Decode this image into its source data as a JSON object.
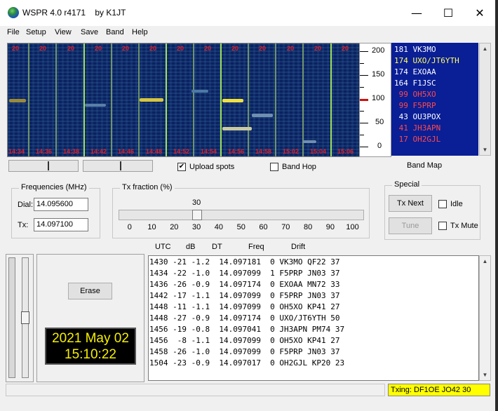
{
  "titlebar": {
    "title": "WSPR 4.0 r4171    by K1JT",
    "minimize": "—",
    "maximize": "☐",
    "close": "✕"
  },
  "menu": [
    "File",
    "Setup",
    "View",
    "Save",
    "Band",
    "Help"
  ],
  "waterfall": {
    "top_labels": [
      "20",
      "20",
      "20",
      "20",
      "20",
      "20",
      "20",
      "20",
      "20",
      "20",
      "20",
      "20",
      "20"
    ],
    "time_labels": [
      "14:34",
      "14:36",
      "14:38",
      "14:42",
      "14:46",
      "14:48",
      "14:52",
      "14:54",
      "14:56",
      "14:58",
      "15:02",
      "15:04",
      "15:06"
    ]
  },
  "scale": {
    "labels": [
      "200",
      "150",
      "100",
      "50",
      "0"
    ],
    "marker_value": 100
  },
  "band_map": {
    "label": "Band Map",
    "entries": [
      {
        "offset": "181",
        "call": "VK3MO",
        "color": "#ffffff"
      },
      {
        "offset": "174",
        "call": "UXO/JT6YTH",
        "color": "#ffff60"
      },
      {
        "offset": "174",
        "call": "EXOAA",
        "color": "#ffffff"
      },
      {
        "offset": "164",
        "call": "F1JSC",
        "color": "#ffffff"
      },
      {
        "offset": " 99",
        "call": "OH5XO",
        "color": "#ff4a4a"
      },
      {
        "offset": " 99",
        "call": "F5PRP",
        "color": "#ff4a4a"
      },
      {
        "offset": " 43",
        "call": "OU3POX",
        "color": "#ffffff"
      },
      {
        "offset": " 41",
        "call": "JH3APN",
        "color": "#ff4a4a"
      },
      {
        "offset": " 17",
        "call": "OH2GJL",
        "color": "#ff4a4a"
      }
    ]
  },
  "options": {
    "upload_spots": "Upload spots",
    "upload_checked": "✔",
    "band_hop": "Band Hop"
  },
  "frequencies": {
    "title": "Frequencies (MHz)",
    "dial_label": "Dial:",
    "dial_value": "14.095600",
    "tx_label": "Tx:",
    "tx_value": "14.097100"
  },
  "tx_fraction": {
    "title": "Tx fraction (%)",
    "value": "30",
    "ticks": [
      "0",
      "10",
      "20",
      "30",
      "40",
      "50",
      "60",
      "70",
      "80",
      "90",
      "100"
    ],
    "fraction": 0.3
  },
  "special": {
    "title": "Special",
    "tx_next": "Tx Next",
    "idle": "Idle",
    "tune": "Tune",
    "tx_mute": "Tx Mute"
  },
  "columns": {
    "utc": "UTC",
    "db": "dB",
    "dt": "DT",
    "freq": "Freq",
    "drift": "Drift"
  },
  "log": [
    "1430 -21 -1.2  14.097181  0 VK3MO QF22 37",
    "1434 -22 -1.0  14.097099  1 F5PRP JN03 37",
    "1436 -26 -0.9  14.097174  0 EXOAA MN72 33",
    "1442 -17 -1.1  14.097099  0 F5PRP JN03 37",
    "1448 -11 -1.1  14.097099  0 OH5XO KP41 27",
    "1448 -27 -0.9  14.097174  0 UXO/JT6YTH 50",
    "1456 -19 -0.8  14.097041  0 JH3APN PM74 37",
    "1456  -8 -1.1  14.097099  0 OH5XO KP41 27",
    "1458 -26 -1.0  14.097099  0 F5PRP JN03 37",
    "1504 -23 -0.9  14.097017  0 OH2GJL KP20 23"
  ],
  "erase": "Erase",
  "clock": {
    "date": "2021 May 02",
    "time": "15:10:22"
  },
  "status": {
    "txing": "Txing: DF1OE JO42 30"
  }
}
